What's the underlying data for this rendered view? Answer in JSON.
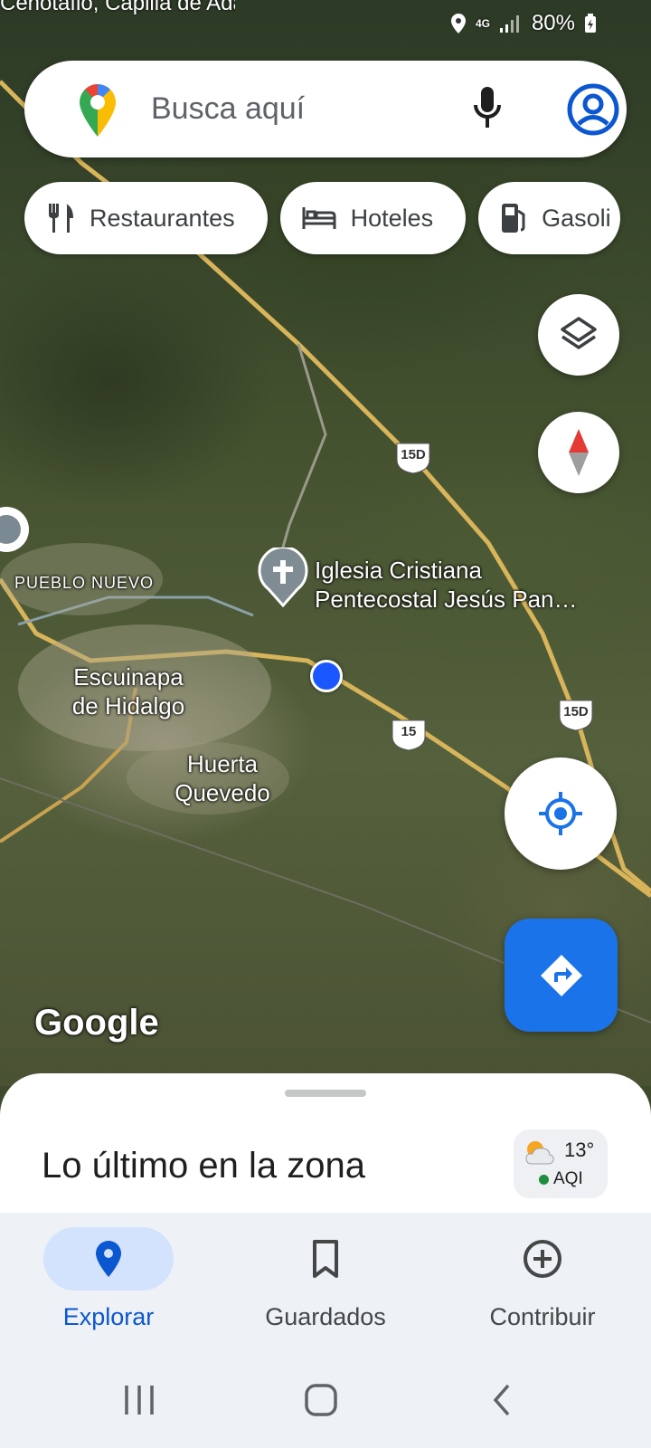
{
  "status_bar": {
    "ticker_text": "Cenotafio, Capilla de Adan Chalino Sanchez",
    "network": "4G",
    "battery": "80%"
  },
  "search": {
    "placeholder": "Busca aquí"
  },
  "chips": [
    {
      "label": "Restaurantes",
      "icon": "restaurant-icon"
    },
    {
      "label": "Hoteles",
      "icon": "hotel-icon"
    },
    {
      "label": "Gasoli",
      "icon": "gas-station-icon"
    }
  ],
  "map": {
    "labels": {
      "pueblo_nuevo": "PUEBLO NUEVO",
      "escuinapa": "Escuinapa de Hidalgo",
      "huerta": "Huerta Quevedo",
      "church_line1": "Iglesia Cristiana",
      "church_line2": "Pentecostal Jesús Pan…"
    },
    "shields": [
      "15D",
      "15",
      "15D"
    ],
    "watermark": "Google"
  },
  "sheet": {
    "title": "Lo último en la zona",
    "weather": {
      "temp": "13°",
      "aqi": "AQI"
    }
  },
  "nav": {
    "items": [
      {
        "label": "Explorar",
        "icon": "explore-pin-icon",
        "active": true
      },
      {
        "label": "Guardados",
        "icon": "bookmark-icon",
        "active": false
      },
      {
        "label": "Contribuir",
        "icon": "add-circle-icon",
        "active": false
      }
    ]
  },
  "colors": {
    "accent": "#0b57d0",
    "directions_fab": "#1a73e8",
    "nav_bg": "#eef1f5",
    "road": "#d8b45a"
  }
}
